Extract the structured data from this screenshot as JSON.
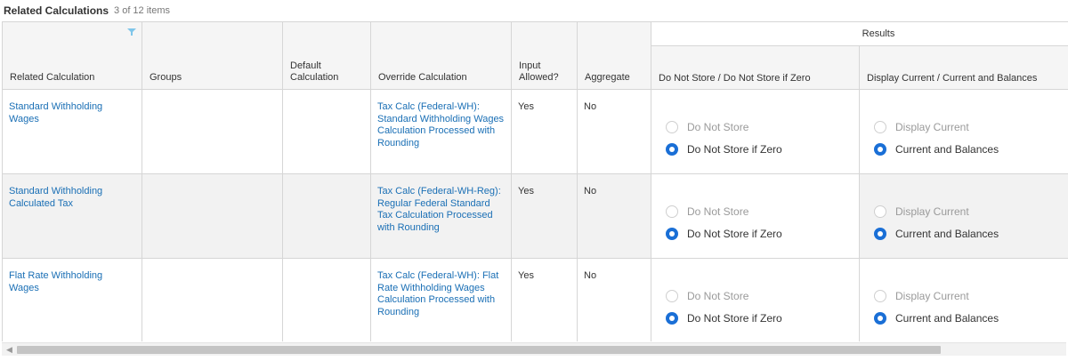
{
  "header": {
    "title": "Related Calculations",
    "count": "3 of 12 items"
  },
  "columns": {
    "related_calculation": "Related Calculation",
    "groups": "Groups",
    "default_calculation": "Default Calculation",
    "override_calculation": "Override Calculation",
    "input_allowed": "Input Allowed?",
    "aggregate": "Aggregate",
    "results": "Results",
    "store": "Do Not Store / Do Not Store if Zero",
    "display": "Display Current / Current and Balances"
  },
  "rows": [
    {
      "related": "Standard Withholding Wages",
      "groups": "",
      "default": "",
      "override": "Tax Calc (Federal-WH): Standard Withholding Wages Calculation Processed with Rounding",
      "input_allowed": "Yes",
      "aggregate": "No",
      "store_options": [
        "Do Not Store",
        "Do Not Store if Zero"
      ],
      "store_selected": "Do Not Store if Zero",
      "display_options": [
        "Display Current",
        "Current and Balances"
      ],
      "display_selected": "Current and Balances"
    },
    {
      "related": "Standard Withholding Calculated Tax",
      "groups": "",
      "default": "",
      "override": "Tax Calc (Federal-WH-Reg): Regular Federal Standard Tax Calculation Processed with Rounding",
      "input_allowed": "Yes",
      "aggregate": "No",
      "store_options": [
        "Do Not Store",
        "Do Not Store if Zero"
      ],
      "store_selected": "Do Not Store if Zero",
      "display_options": [
        "Display Current",
        "Current and Balances"
      ],
      "display_selected": "Current and Balances"
    },
    {
      "related": "Flat Rate Withholding Wages",
      "groups": "",
      "default": "",
      "override": "Tax Calc (Federal-WH): Flat Rate Withholding Wages Calculation Processed with Rounding",
      "input_allowed": "Yes",
      "aggregate": "No",
      "store_options": [
        "Do Not Store",
        "Do Not Store if Zero"
      ],
      "store_selected": "Do Not Store if Zero",
      "display_options": [
        "Display Current",
        "Current and Balances"
      ],
      "display_selected": "Current and Balances"
    }
  ],
  "icons": {
    "filter": "filter-icon",
    "scroll_left": "chevron-left-icon"
  },
  "colors": {
    "link": "#1a6fb5",
    "radio_selected": "#1a6fd6",
    "header_bg": "#f5f5f5",
    "alt_row_bg": "#f2f2f2"
  }
}
